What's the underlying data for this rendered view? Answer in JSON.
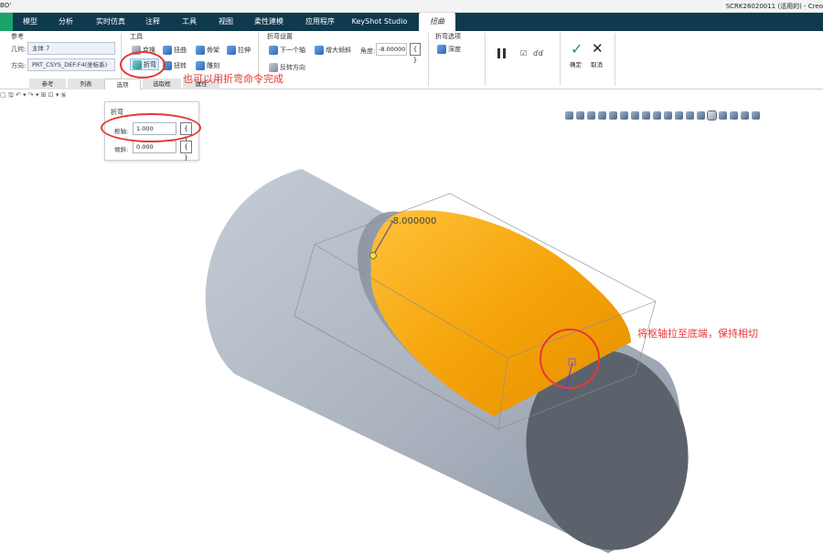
{
  "titlebar": {
    "left_text": "BO'",
    "right_text": "SCRK26020011 (活用的) - Creo"
  },
  "tabs": [
    {
      "label": "模型"
    },
    {
      "label": "分析"
    },
    {
      "label": "实时仿真"
    },
    {
      "label": "注释"
    },
    {
      "label": "工具"
    },
    {
      "label": "视图"
    },
    {
      "label": "柔性建模"
    },
    {
      "label": "应用程序"
    },
    {
      "label": "KeyShot Studio"
    },
    {
      "label": "扭曲"
    }
  ],
  "references": {
    "group_title": "参考",
    "geometry_label": "几何:",
    "geometry_value": "主体 7",
    "direction_label": "方向:",
    "direction_value": "PRT_CSYS_DEF:F4(坐标系)"
  },
  "tools": {
    "group_title": "工具",
    "transform": "变换",
    "twist": "扭曲",
    "spine": "骨架",
    "stretch": "拉伸",
    "bend": "折弯",
    "rotate": "扭转",
    "sculpt": "雕刻"
  },
  "bend_settings": {
    "group_title": "折弯设置",
    "next_axis": "下一个轴",
    "increase_taper": "增大倾斜",
    "angle_label": "角度:",
    "angle_value": "-8.00000",
    "brace": "{ }",
    "reverse_direction": "反转方向"
  },
  "bend_options": {
    "group_title": "折弯选项",
    "depth": "深度"
  },
  "actions": {
    "confirm": "确定",
    "cancel": "取消",
    "checkmark_glyph": "✓",
    "close_glyph": "✕",
    "glasses_glyph": "ɗɗ"
  },
  "subtabs": [
    {
      "label": "参考"
    },
    {
      "label": "列表"
    },
    {
      "label": "选项"
    },
    {
      "label": "选取框"
    },
    {
      "label": "属性"
    }
  ],
  "options_popup": {
    "title": "折弯",
    "pivot_label": "枢轴:",
    "pivot_value": "1.000",
    "taper_label": "倾斜:",
    "taper_value": "0.000",
    "brace": "{ }"
  },
  "quick_toolbar": "▢ 🖫 ↶ ▾ ↷ ▾ ⊞ ⊡ ▾ ≶",
  "viewport": {
    "dimension_label": "-8.000000",
    "annotation_bend": "也可以用折弯命令完成",
    "annotation_pivot": "将枢轴拉至底端，保持相切"
  },
  "colors": {
    "tab_bar": "#0f3a4e",
    "cylinder": "#a9b2be",
    "cut_surface": "#f5a40a",
    "annotation": "#e53935"
  }
}
